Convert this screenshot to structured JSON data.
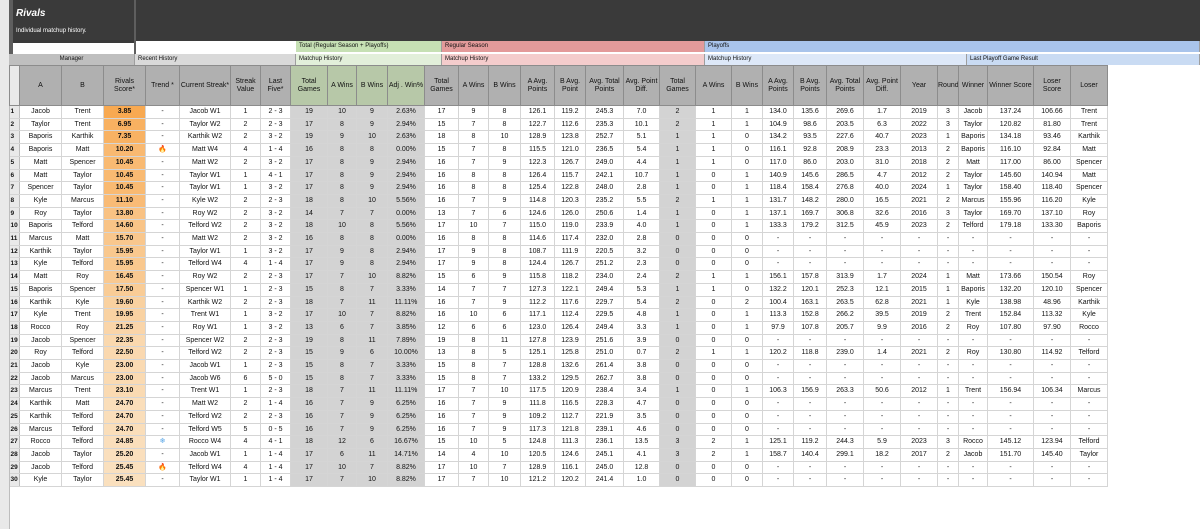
{
  "app": {
    "title": "Rivals",
    "subtitle": "Individual matchup history."
  },
  "groups": {
    "total": "Total (Regular Season + Playoffs)",
    "regular": "Regular Season",
    "playoffs": "Playoffs"
  },
  "subgroups": {
    "manager": "Manager",
    "recent": "Recent History",
    "total": "Matchup History",
    "regular": "Matchup History",
    "playoffs": "Matchup History",
    "lastgame": "Last Playoff Game Result"
  },
  "columns": [
    "A",
    "B",
    "Rivals Score*",
    "Trend *",
    "Current Streak*",
    "Streak Value",
    "Last Five*",
    "Total Games",
    "A Wins",
    "B Wins",
    "Adj . Win%",
    "Total Games",
    "A Wins",
    "B Wins",
    "A Avg. Points",
    "B Avg. Point",
    "Avg. Total Points",
    "Avg. Point Diff.",
    "Total Games",
    "A Wins",
    "B Wins",
    "A Avg. Points",
    "B Avg. Points",
    "Avg. Total Points",
    "Avg. Point Diff.",
    "Year",
    "Round",
    "Winner",
    "Winner Score",
    "Loser Score",
    "Loser"
  ],
  "colors": {
    "header_dark": "#3a3a3a",
    "total_group": "#c6e0b4",
    "regular_group": "#e39a9a",
    "playoffs_group": "#a9c4eb",
    "lastgame_group": "#c9dbf3",
    "score_high": "#f8a951",
    "score_low": "#f5d7b0",
    "shade": "#d3d3d3"
  },
  "icons": {
    "fire": "fire-icon",
    "snow": "snowflake-icon"
  },
  "rows": [
    [
      "1",
      "Jacob",
      "Trent",
      "3.85",
      "-",
      "Jacob W1",
      "1",
      "2 - 3",
      "19",
      "10",
      "9",
      "2.63%",
      "17",
      "9",
      "8",
      "126.1",
      "119.2",
      "245.3",
      "7.0",
      "2",
      "1",
      "1",
      "134.0",
      "135.6",
      "269.6",
      "1.7",
      "2019",
      "3",
      "Jacob",
      "137.24",
      "106.66",
      "Trent"
    ],
    [
      "2",
      "Taylor",
      "Trent",
      "6.95",
      "-",
      "Taylor W2",
      "2",
      "2 - 3",
      "17",
      "8",
      "9",
      "2.94%",
      "15",
      "7",
      "8",
      "122.7",
      "112.6",
      "235.3",
      "10.1",
      "2",
      "1",
      "1",
      "104.9",
      "98.6",
      "203.5",
      "6.3",
      "2022",
      "3",
      "Taylor",
      "120.82",
      "81.80",
      "Trent"
    ],
    [
      "3",
      "Baporis",
      "Karthik",
      "7.35",
      "-",
      "Karthik W2",
      "2",
      "3 - 2",
      "19",
      "9",
      "10",
      "2.63%",
      "18",
      "8",
      "10",
      "128.9",
      "123.8",
      "252.7",
      "5.1",
      "1",
      "1",
      "0",
      "134.2",
      "93.5",
      "227.6",
      "40.7",
      "2023",
      "1",
      "Baporis",
      "134.18",
      "93.46",
      "Karthik"
    ],
    [
      "4",
      "Baporis",
      "Matt",
      "10.20",
      "fire",
      "Matt W4",
      "4",
      "1 - 4",
      "16",
      "8",
      "8",
      "0.00%",
      "15",
      "7",
      "8",
      "115.5",
      "121.0",
      "236.5",
      "5.4",
      "1",
      "1",
      "0",
      "116.1",
      "92.8",
      "208.9",
      "23.3",
      "2013",
      "2",
      "Baporis",
      "116.10",
      "92.84",
      "Matt"
    ],
    [
      "5",
      "Matt",
      "Spencer",
      "10.45",
      "-",
      "Matt W2",
      "2",
      "3 - 2",
      "17",
      "8",
      "9",
      "2.94%",
      "16",
      "7",
      "9",
      "122.3",
      "126.7",
      "249.0",
      "4.4",
      "1",
      "1",
      "0",
      "117.0",
      "86.0",
      "203.0",
      "31.0",
      "2018",
      "2",
      "Matt",
      "117.00",
      "86.00",
      "Spencer"
    ],
    [
      "6",
      "Matt",
      "Taylor",
      "10.45",
      "-",
      "Taylor W1",
      "1",
      "4 - 1",
      "17",
      "8",
      "9",
      "2.94%",
      "16",
      "8",
      "8",
      "126.4",
      "115.7",
      "242.1",
      "10.7",
      "1",
      "0",
      "1",
      "140.9",
      "145.6",
      "286.5",
      "4.7",
      "2012",
      "2",
      "Taylor",
      "145.60",
      "140.94",
      "Matt"
    ],
    [
      "7",
      "Spencer",
      "Taylor",
      "10.45",
      "-",
      "Taylor W1",
      "1",
      "3 - 2",
      "17",
      "8",
      "9",
      "2.94%",
      "16",
      "8",
      "8",
      "125.4",
      "122.8",
      "248.0",
      "2.8",
      "1",
      "0",
      "1",
      "118.4",
      "158.4",
      "276.8",
      "40.0",
      "2024",
      "1",
      "Taylor",
      "158.40",
      "118.40",
      "Spencer"
    ],
    [
      "8",
      "Kyle",
      "Marcus",
      "11.10",
      "-",
      "Kyle W2",
      "2",
      "2 - 3",
      "18",
      "8",
      "10",
      "5.56%",
      "16",
      "7",
      "9",
      "114.8",
      "120.3",
      "235.2",
      "5.5",
      "2",
      "1",
      "1",
      "131.7",
      "148.2",
      "280.0",
      "16.5",
      "2021",
      "2",
      "Marcus",
      "155.96",
      "116.20",
      "Kyle"
    ],
    [
      "9",
      "Roy",
      "Taylor",
      "13.80",
      "-",
      "Roy W2",
      "2",
      "3 - 2",
      "14",
      "7",
      "7",
      "0.00%",
      "13",
      "7",
      "6",
      "124.6",
      "126.0",
      "250.6",
      "1.4",
      "1",
      "0",
      "1",
      "137.1",
      "169.7",
      "306.8",
      "32.6",
      "2016",
      "3",
      "Taylor",
      "169.70",
      "137.10",
      "Roy"
    ],
    [
      "10",
      "Baporis",
      "Telford",
      "14.60",
      "-",
      "Telford W2",
      "2",
      "3 - 2",
      "18",
      "10",
      "8",
      "5.56%",
      "17",
      "10",
      "7",
      "115.0",
      "119.0",
      "233.9",
      "4.0",
      "1",
      "0",
      "1",
      "133.3",
      "179.2",
      "312.5",
      "45.9",
      "2023",
      "2",
      "Telford",
      "179.18",
      "133.30",
      "Baporis"
    ],
    [
      "11",
      "Marcus",
      "Matt",
      "15.70",
      "-",
      "Matt W2",
      "2",
      "3 - 2",
      "16",
      "8",
      "8",
      "0.00%",
      "16",
      "8",
      "8",
      "114.6",
      "117.4",
      "232.0",
      "2.8",
      "0",
      "0",
      "0",
      "-",
      "-",
      "-",
      "-",
      "-",
      "-",
      "-",
      "-",
      "-",
      "-"
    ],
    [
      "12",
      "Karthik",
      "Taylor",
      "15.95",
      "-",
      "Taylor W1",
      "1",
      "3 - 2",
      "17",
      "9",
      "8",
      "2.94%",
      "17",
      "9",
      "8",
      "108.7",
      "111.9",
      "220.5",
      "3.2",
      "0",
      "0",
      "0",
      "-",
      "-",
      "-",
      "-",
      "-",
      "-",
      "-",
      "-",
      "-",
      "-"
    ],
    [
      "13",
      "Kyle",
      "Telford",
      "15.95",
      "-",
      "Telford W4",
      "4",
      "1 - 4",
      "17",
      "9",
      "8",
      "2.94%",
      "17",
      "9",
      "8",
      "124.4",
      "126.7",
      "251.2",
      "2.3",
      "0",
      "0",
      "0",
      "-",
      "-",
      "-",
      "-",
      "-",
      "-",
      "-",
      "-",
      "-",
      "-"
    ],
    [
      "14",
      "Matt",
      "Roy",
      "16.45",
      "-",
      "Roy W2",
      "2",
      "2 - 3",
      "17",
      "7",
      "10",
      "8.82%",
      "15",
      "6",
      "9",
      "115.8",
      "118.2",
      "234.0",
      "2.4",
      "2",
      "1",
      "1",
      "156.1",
      "157.8",
      "313.9",
      "1.7",
      "2024",
      "1",
      "Matt",
      "173.66",
      "150.54",
      "Roy"
    ],
    [
      "15",
      "Baporis",
      "Spencer",
      "17.50",
      "-",
      "Spencer W1",
      "1",
      "2 - 3",
      "15",
      "8",
      "7",
      "3.33%",
      "14",
      "7",
      "7",
      "127.3",
      "122.1",
      "249.4",
      "5.3",
      "1",
      "1",
      "0",
      "132.2",
      "120.1",
      "252.3",
      "12.1",
      "2015",
      "1",
      "Baporis",
      "132.20",
      "120.10",
      "Spencer"
    ],
    [
      "16",
      "Karthik",
      "Kyle",
      "19.60",
      "-",
      "Karthik W2",
      "2",
      "2 - 3",
      "18",
      "7",
      "11",
      "11.11%",
      "16",
      "7",
      "9",
      "112.2",
      "117.6",
      "229.7",
      "5.4",
      "2",
      "0",
      "2",
      "100.4",
      "163.1",
      "263.5",
      "62.8",
      "2021",
      "1",
      "Kyle",
      "138.98",
      "48.96",
      "Karthik"
    ],
    [
      "17",
      "Kyle",
      "Trent",
      "19.95",
      "-",
      "Trent W1",
      "1",
      "3 - 2",
      "17",
      "10",
      "7",
      "8.82%",
      "16",
      "10",
      "6",
      "117.1",
      "112.4",
      "229.5",
      "4.8",
      "1",
      "0",
      "1",
      "113.3",
      "152.8",
      "266.2",
      "39.5",
      "2019",
      "2",
      "Trent",
      "152.84",
      "113.32",
      "Kyle"
    ],
    [
      "18",
      "Rocco",
      "Roy",
      "21.25",
      "-",
      "Roy W1",
      "1",
      "3 - 2",
      "13",
      "6",
      "7",
      "3.85%",
      "12",
      "6",
      "6",
      "123.0",
      "126.4",
      "249.4",
      "3.3",
      "1",
      "0",
      "1",
      "97.9",
      "107.8",
      "205.7",
      "9.9",
      "2016",
      "2",
      "Roy",
      "107.80",
      "97.90",
      "Rocco"
    ],
    [
      "19",
      "Jacob",
      "Spencer",
      "22.35",
      "-",
      "Spencer W2",
      "2",
      "2 - 3",
      "19",
      "8",
      "11",
      "7.89%",
      "19",
      "8",
      "11",
      "127.8",
      "123.9",
      "251.6",
      "3.9",
      "0",
      "0",
      "0",
      "-",
      "-",
      "-",
      "-",
      "-",
      "-",
      "-",
      "-",
      "-",
      "-"
    ],
    [
      "20",
      "Roy",
      "Telford",
      "22.50",
      "-",
      "Telford W2",
      "2",
      "2 - 3",
      "15",
      "9",
      "6",
      "10.00%",
      "13",
      "8",
      "5",
      "125.1",
      "125.8",
      "251.0",
      "0.7",
      "2",
      "1",
      "1",
      "120.2",
      "118.8",
      "239.0",
      "1.4",
      "2021",
      "2",
      "Roy",
      "130.80",
      "114.92",
      "Telford"
    ],
    [
      "21",
      "Jacob",
      "Kyle",
      "23.00",
      "-",
      "Jacob W1",
      "1",
      "2 - 3",
      "15",
      "8",
      "7",
      "3.33%",
      "15",
      "8",
      "7",
      "128.8",
      "132.6",
      "261.4",
      "3.8",
      "0",
      "0",
      "0",
      "-",
      "-",
      "-",
      "-",
      "-",
      "-",
      "-",
      "-",
      "-",
      "-"
    ],
    [
      "22",
      "Jacob",
      "Marcus",
      "23.00",
      "-",
      "Jacob W6",
      "6",
      "5 - 0",
      "15",
      "8",
      "7",
      "3.33%",
      "15",
      "8",
      "7",
      "133.2",
      "129.5",
      "262.7",
      "3.8",
      "0",
      "0",
      "0",
      "-",
      "-",
      "-",
      "-",
      "-",
      "-",
      "-",
      "-",
      "-",
      "-"
    ],
    [
      "23",
      "Marcus",
      "Trent",
      "23.10",
      "-",
      "Trent W1",
      "1",
      "2 - 3",
      "18",
      "7",
      "11",
      "11.11%",
      "17",
      "7",
      "10",
      "117.5",
      "120.9",
      "238.4",
      "3.4",
      "1",
      "0",
      "1",
      "106.3",
      "156.9",
      "263.3",
      "50.6",
      "2012",
      "1",
      "Trent",
      "156.94",
      "106.34",
      "Marcus"
    ],
    [
      "24",
      "Karthik",
      "Matt",
      "24.70",
      "-",
      "Matt W2",
      "2",
      "1 - 4",
      "16",
      "7",
      "9",
      "6.25%",
      "16",
      "7",
      "9",
      "111.8",
      "116.5",
      "228.3",
      "4.7",
      "0",
      "0",
      "0",
      "-",
      "-",
      "-",
      "-",
      "-",
      "-",
      "-",
      "-",
      "-",
      "-"
    ],
    [
      "25",
      "Karthik",
      "Telford",
      "24.70",
      "-",
      "Telford W2",
      "2",
      "2 - 3",
      "16",
      "7",
      "9",
      "6.25%",
      "16",
      "7",
      "9",
      "109.2",
      "112.7",
      "221.9",
      "3.5",
      "0",
      "0",
      "0",
      "-",
      "-",
      "-",
      "-",
      "-",
      "-",
      "-",
      "-",
      "-",
      "-"
    ],
    [
      "26",
      "Marcus",
      "Telford",
      "24.70",
      "-",
      "Telford W5",
      "5",
      "0 - 5",
      "16",
      "7",
      "9",
      "6.25%",
      "16",
      "7",
      "9",
      "117.3",
      "121.8",
      "239.1",
      "4.6",
      "0",
      "0",
      "0",
      "-",
      "-",
      "-",
      "-",
      "-",
      "-",
      "-",
      "-",
      "-",
      "-"
    ],
    [
      "27",
      "Rocco",
      "Telford",
      "24.85",
      "snow",
      "Rocco W4",
      "4",
      "4 - 1",
      "18",
      "12",
      "6",
      "16.67%",
      "15",
      "10",
      "5",
      "124.8",
      "111.3",
      "236.1",
      "13.5",
      "3",
      "2",
      "1",
      "125.1",
      "119.2",
      "244.3",
      "5.9",
      "2023",
      "3",
      "Rocco",
      "145.12",
      "123.94",
      "Telford"
    ],
    [
      "28",
      "Jacob",
      "Taylor",
      "25.20",
      "-",
      "Jacob W1",
      "1",
      "1 - 4",
      "17",
      "6",
      "11",
      "14.71%",
      "14",
      "4",
      "10",
      "120.5",
      "124.6",
      "245.1",
      "4.1",
      "3",
      "2",
      "1",
      "158.7",
      "140.4",
      "299.1",
      "18.2",
      "2017",
      "2",
      "Jacob",
      "151.70",
      "145.40",
      "Taylor"
    ],
    [
      "29",
      "Jacob",
      "Telford",
      "25.45",
      "fire",
      "Telford W4",
      "4",
      "1 - 4",
      "17",
      "10",
      "7",
      "8.82%",
      "17",
      "10",
      "7",
      "128.9",
      "116.1",
      "245.0",
      "12.8",
      "0",
      "0",
      "0",
      "-",
      "-",
      "-",
      "-",
      "-",
      "-",
      "-",
      "-",
      "-",
      "-"
    ],
    [
      "30",
      "Kyle",
      "Taylor",
      "25.45",
      "-",
      "Taylor W1",
      "1",
      "1 - 4",
      "17",
      "7",
      "10",
      "8.82%",
      "17",
      "7",
      "10",
      "121.2",
      "120.2",
      "241.4",
      "1.0",
      "0",
      "0",
      "0",
      "-",
      "-",
      "-",
      "-",
      "-",
      "-",
      "-",
      "-",
      "-",
      "-"
    ]
  ]
}
